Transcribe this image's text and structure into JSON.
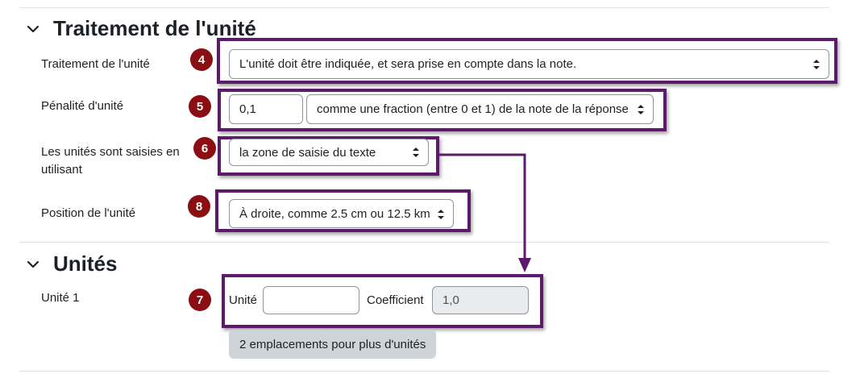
{
  "sections": {
    "unit_handling_title": "Traitement de l'unité",
    "units_title": "Unités"
  },
  "fields": {
    "unit_handling": {
      "label": "Traitement de l'unité",
      "value": "L'unité doit être indiquée, et sera prise en compte dans la note."
    },
    "unit_penalty": {
      "label": "Pénalité d'unité",
      "value": "0,1",
      "mode": "comme une fraction (entre 0 et 1) de la note de la réponse"
    },
    "units_input": {
      "label": "Les unités sont saisies en utilisant",
      "value": "la zone de saisie du texte"
    },
    "unit_position": {
      "label": "Position de l'unité",
      "value": "À droite, comme 2.5 cm ou 12.5 km"
    },
    "unit_1": {
      "label": "Unité 1",
      "unit_label": "Unité",
      "unit_value": "",
      "coefficient_label": "Coefficient",
      "coefficient_value": "1,0"
    }
  },
  "add_more_button": "2 emplacements pour plus d'unités",
  "badges": [
    "4",
    "5",
    "6",
    "8",
    "7"
  ],
  "colors": {
    "annotation_frame": "#5c1a6b",
    "badge": "#8b0f12"
  }
}
